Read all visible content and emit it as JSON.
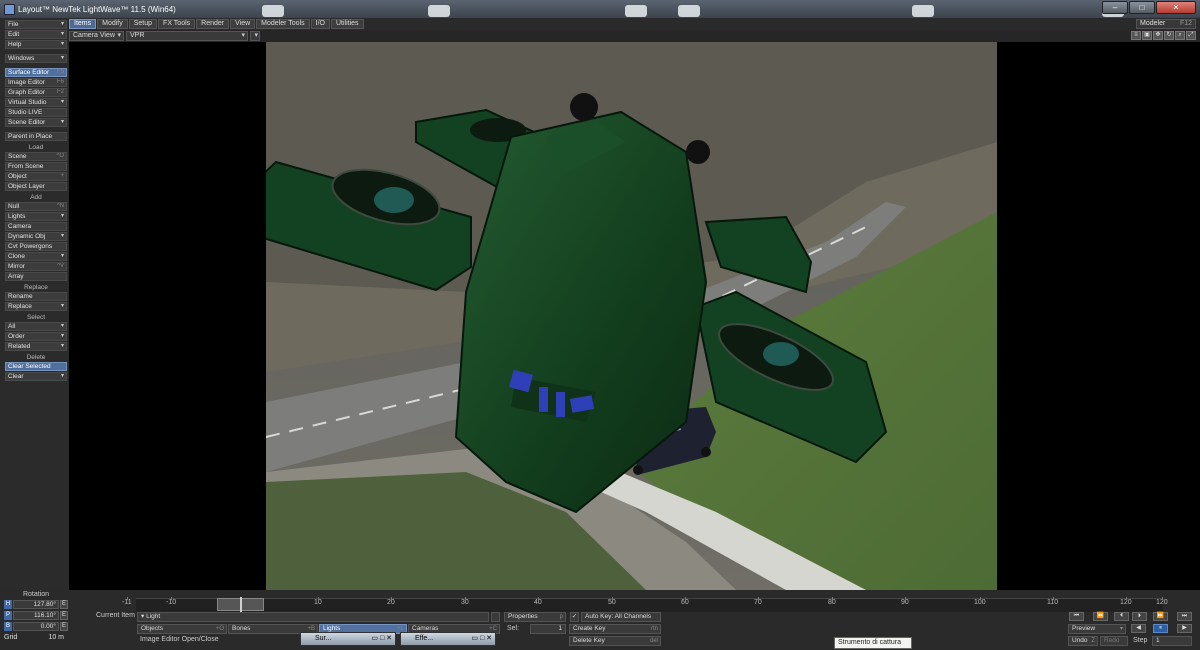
{
  "window": {
    "title": "Layout™ NewTek LightWave™ 11.5 (Win64)"
  },
  "tabs": [
    "Items",
    "Modify",
    "Setup",
    "FX Tools",
    "Render",
    "View",
    "Modeler Tools",
    "I/O",
    "Utilities"
  ],
  "modeler": {
    "label": "Modeler",
    "key": "F12"
  },
  "view": {
    "camera": "Camera View",
    "mode": "VPR"
  },
  "toolbar": {
    "top": [
      {
        "label": "File",
        "arrow": true
      },
      {
        "label": "Edit",
        "arrow": true
      },
      {
        "label": "Help",
        "arrow": true
      }
    ],
    "windows": [
      {
        "label": "Windows",
        "arrow": true
      }
    ],
    "editors": [
      {
        "label": "Surface Editor",
        "key": "F5",
        "hl": true
      },
      {
        "label": "Image Editor",
        "key": "F6"
      },
      {
        "label": "Graph Editor",
        "key": "F2"
      },
      {
        "label": "Virtual Studio",
        "arrow": true
      },
      {
        "label": "Studio LIVE"
      },
      {
        "label": "Scene Editor",
        "arrow": true
      }
    ],
    "parent": [
      {
        "label": "Parent in Place"
      }
    ],
    "load_title": "Load",
    "load": [
      {
        "label": "Scene",
        "key": "^O"
      },
      {
        "label": "From Scene"
      },
      {
        "label": "Object",
        "key": "+"
      },
      {
        "label": "Object Layer"
      }
    ],
    "add_title": "Add",
    "add": [
      {
        "label": "Null",
        "key": "^N"
      },
      {
        "label": "Lights",
        "arrow": true
      },
      {
        "label": "Camera"
      },
      {
        "label": "Dynamic Obj",
        "arrow": true
      },
      {
        "label": "Cvt Powergons"
      },
      {
        "label": "Clone",
        "arrow": true
      },
      {
        "label": "Mirror",
        "key": "^V"
      },
      {
        "label": "Array"
      }
    ],
    "replace_title": "Replace",
    "replace": [
      {
        "label": "Rename"
      },
      {
        "label": "Replace",
        "arrow": true
      }
    ],
    "select_title": "Select",
    "select": [
      {
        "label": "All",
        "arrow": true
      },
      {
        "label": "Order",
        "arrow": true
      },
      {
        "label": "Related",
        "arrow": true
      }
    ],
    "delete_title": "Delete",
    "delete": [
      {
        "label": "Clear Selected",
        "hl": true
      },
      {
        "label": "Clear",
        "arrow": true
      }
    ]
  },
  "timeline": {
    "ticks": [
      "-11",
      "-10",
      "0",
      "10",
      "20",
      "30",
      "40",
      "50",
      "60",
      "70",
      "80",
      "90",
      "100",
      "110",
      "120",
      "120"
    ],
    "current_frame": "0"
  },
  "rotation": {
    "label": "Rotation",
    "h": {
      "axis": "H",
      "value": "127.80°"
    },
    "p": {
      "axis": "P",
      "value": "116.10°"
    },
    "b": {
      "axis": "B",
      "value": "0.00°"
    },
    "grid_label": "Grid",
    "grid_value": "10 m"
  },
  "bottom": {
    "current_item_label": "Current Item",
    "current_item": "Light",
    "objects": "Objects",
    "objects_key": "+O",
    "bones": "Bones",
    "bones_key": "+B",
    "lights": "Lights",
    "lights_key": "+L",
    "cameras": "Cameras",
    "cameras_key": "+C",
    "properties": "Properties",
    "properties_key": "p",
    "sel_label": "Sel:",
    "sel_value": "1",
    "auto_key": "Auto Key: All Channels",
    "create_key": "Create Key",
    "create_key_k": "rtn",
    "delete_key": "Delete Key",
    "delete_key_k": "del",
    "preview": "Preview",
    "step_label": "Step",
    "step_value": "1",
    "undo": "Undo",
    "redo": "Redo",
    "status": "Image Editor Open/Close"
  },
  "taskbar": {
    "thumb1": "Sur...",
    "thumb2": "Effe..."
  },
  "tooltip": "Strumento di cattura"
}
